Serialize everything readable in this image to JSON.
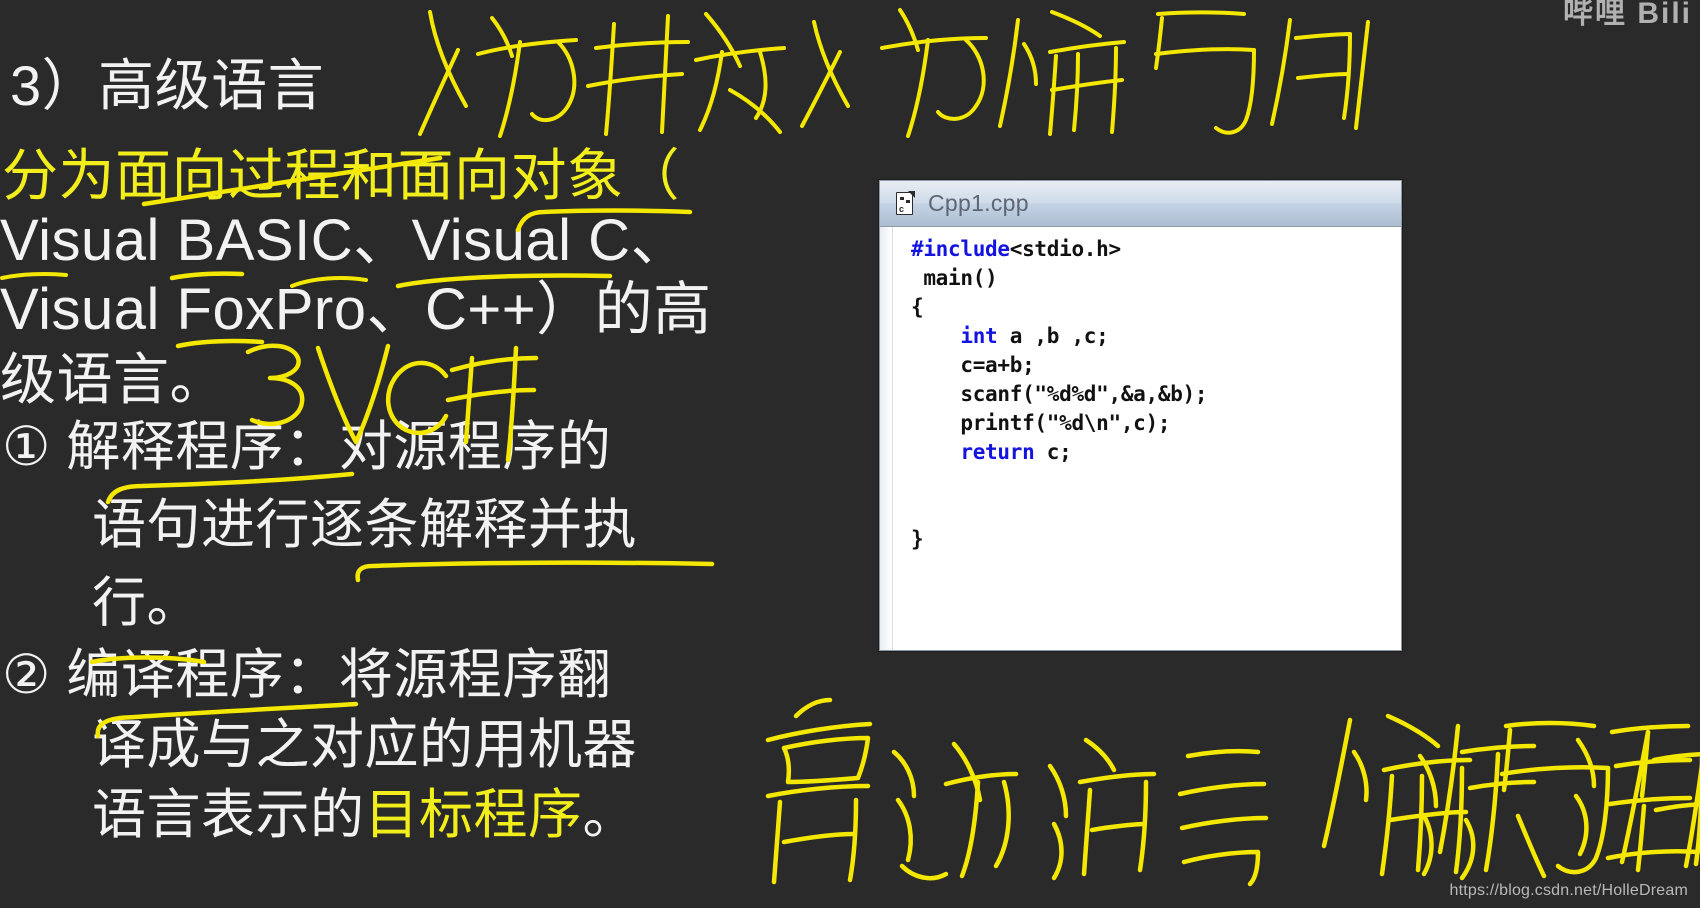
{
  "slide": {
    "lines": [
      {
        "id": "heading",
        "text": "3）高级语言",
        "color": "white"
      },
      {
        "id": "line2",
        "text": "分为面向过程和面向对象（",
        "color": "yellow"
      },
      {
        "id": "line3",
        "text": "Visual BASIC、Visual C、",
        "color": "white"
      },
      {
        "id": "line4",
        "text": "Visual FoxPro、C++）的高",
        "color": "white"
      },
      {
        "id": "line5",
        "text": "级语言。",
        "color": "white"
      },
      {
        "id": "item1a",
        "text": "①  解释程序：对源程序的",
        "color": "white"
      },
      {
        "id": "item1b",
        "text": "语句进行逐条解释并执",
        "color": "white"
      },
      {
        "id": "item1c",
        "text": "行。",
        "color": "white"
      },
      {
        "id": "item2a",
        "text": "②  编译程序：将源程序翻",
        "color": "white"
      },
      {
        "id": "item2b",
        "text": "译成与之对应的用机器",
        "color": "white"
      },
      {
        "id": "item2c_1",
        "text": "语言表示的",
        "color": "white"
      },
      {
        "id": "item2c_2",
        "text": "目标程序",
        "color": "yellow"
      },
      {
        "id": "item2c_3",
        "text": "。",
        "color": "white"
      }
    ]
  },
  "code_window": {
    "tab_title": "Cpp1.cpp",
    "file_icon": "cpp-file-icon",
    "code_lines": [
      {
        "indent": 0,
        "tokens": [
          {
            "t": "#include",
            "kw": true
          },
          {
            "t": "<stdio.h>",
            "kw": false
          }
        ]
      },
      {
        "indent": 1,
        "tokens": [
          {
            "t": "main()",
            "kw": false
          }
        ]
      },
      {
        "indent": 0,
        "tokens": [
          {
            "t": "{",
            "kw": false
          }
        ]
      },
      {
        "indent": 4,
        "tokens": [
          {
            "t": "int",
            "kw": true
          },
          {
            "t": " a ,b ,c;",
            "kw": false
          }
        ]
      },
      {
        "indent": 4,
        "tokens": [
          {
            "t": "c=a+b;",
            "kw": false
          }
        ]
      },
      {
        "indent": 4,
        "tokens": [
          {
            "t": "scanf(\"%d%d\",&a,&b);",
            "kw": false
          }
        ]
      },
      {
        "indent": 4,
        "tokens": [
          {
            "t": "printf(\"%d\\n\",c);",
            "kw": false
          }
        ]
      },
      {
        "indent": 4,
        "tokens": [
          {
            "t": "return",
            "kw": true
          },
          {
            "t": " c;",
            "kw": false
          }
        ]
      },
      {
        "indent": 0,
        "tokens": []
      },
      {
        "indent": 0,
        "tokens": []
      },
      {
        "indent": 0,
        "tokens": [
          {
            "t": "}",
            "kw": false
          }
        ]
      }
    ]
  },
  "annotations": {
    "ink_color": "#f5e800",
    "top_note": "人为开发人为编写的",
    "mid_note": "3V C开",
    "bottom_note": "高级语言编写的源程序",
    "strokes": [
      "strikethrough-line2",
      "underline-visual-c",
      "underline-basic",
      "underline-foxpro",
      "underline-jieshi-chengxu",
      "underline-zhuxing",
      "underline-xing",
      "underline-bianyi-chengxu"
    ]
  },
  "watermark": {
    "url": "https://blog.csdn.net/HolleDream",
    "corner_logo": "哔哩 Bili"
  },
  "colors": {
    "background": "#2a2a2a",
    "text_white": "#f2f2f2",
    "text_yellow": "#f2ee1b",
    "ink_yellow": "#f5e800",
    "code_keyword": "#1414e0",
    "code_text": "#111111",
    "window_bg": "#ffffff"
  }
}
